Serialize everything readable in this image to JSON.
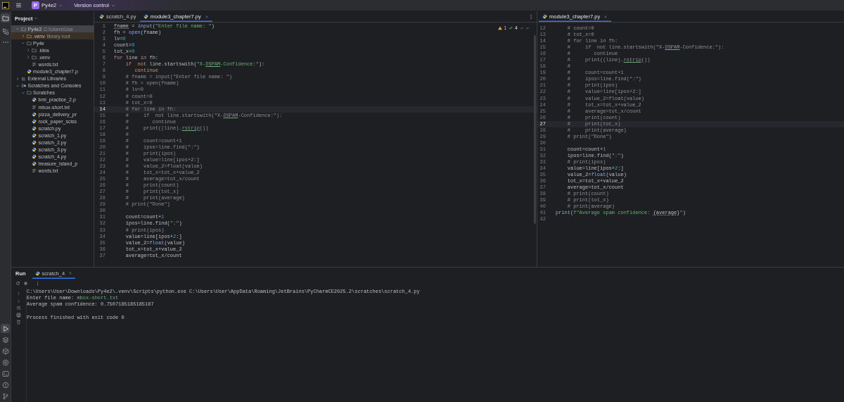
{
  "top_bar": {
    "project_badge": "P",
    "project": "Py4e2",
    "vcs": "Version control"
  },
  "tool_strip": {
    "top": [
      {
        "kind": "project",
        "selected": true
      },
      {
        "kind": "structure",
        "selected": false
      },
      {
        "kind": "more",
        "selected": false
      }
    ],
    "bottom": [
      {
        "kind": "run",
        "selected": true
      },
      {
        "kind": "packages",
        "selected": false
      },
      {
        "kind": "layers",
        "selected": false
      },
      {
        "kind": "console",
        "selected": false
      },
      {
        "kind": "terminal",
        "selected": false
      },
      {
        "kind": "problems",
        "selected": false
      },
      {
        "kind": "vcs",
        "selected": false
      }
    ]
  },
  "project": {
    "title": "Project",
    "tree": [
      {
        "label": "Py4e2",
        "kind": "folder",
        "note": "C:\\Users\\Use",
        "selected": true,
        "expanded": true,
        "children": [
          {
            "label": ".venv",
            "kind": "venv",
            "note": "library root",
            "selected": false,
            "expanded": false
          },
          {
            "label": "Py4e",
            "kind": "folder",
            "selected": false,
            "expanded": true,
            "children": [
              {
                "label": ".idea",
                "kind": "folder",
                "selected": false,
                "expanded": false
              },
              {
                "label": ".venv",
                "kind": "folder",
                "selected": false,
                "expanded": false
              },
              {
                "label": "words.txt",
                "kind": "text",
                "selected": false
              }
            ]
          },
          {
            "label": "module3_chapter7.p",
            "kind": "python",
            "selected": false
          }
        ]
      },
      {
        "label": "External Libraries",
        "kind": "library",
        "selected": false,
        "expanded": false
      },
      {
        "label": "Scratches and Consoles",
        "kind": "scratches",
        "selected": false,
        "expanded": true,
        "children": [
          {
            "label": "Scratches",
            "kind": "folder",
            "selected": false,
            "expanded": true,
            "children": [
              {
                "label": "bmi_practice_2.p",
                "kind": "python",
                "selected": false
              },
              {
                "label": "mbox-short.txt",
                "kind": "text",
                "selected": false
              },
              {
                "label": "pizza_delivery_pr",
                "kind": "python",
                "selected": false
              },
              {
                "label": "rock_paper_sciss",
                "kind": "python",
                "selected": false
              },
              {
                "label": "scratch.py",
                "kind": "python",
                "selected": false
              },
              {
                "label": "scratch_1.py",
                "kind": "python",
                "selected": false
              },
              {
                "label": "scratch_2.py",
                "kind": "python",
                "selected": false
              },
              {
                "label": "scratch_3.py",
                "kind": "python",
                "selected": false
              },
              {
                "label": "scratch_4.py",
                "kind": "python",
                "selected": false
              },
              {
                "label": "treasure_island_p",
                "kind": "python",
                "selected": false
              },
              {
                "label": "words.txt",
                "kind": "text",
                "selected": false
              }
            ]
          }
        ]
      }
    ]
  },
  "editors": [
    {
      "tabs": [
        {
          "label": "scratch_4.py",
          "selected": false
        },
        {
          "label": "module3_chapter7.py",
          "selected": true
        }
      ],
      "inspections": {
        "warnings": "1",
        "checks": "4"
      },
      "lines": [
        {
          "n": "1",
          "current": false,
          "segs": [
            {
              "kind": "marked",
              "text": "fname"
            },
            {
              "kind": "plain",
              "text": " = "
            },
            {
              "kind": "builtin",
              "text": "input"
            },
            {
              "kind": "plain",
              "text": "("
            },
            {
              "kind": "string",
              "text": "\"Enter file name: \""
            },
            {
              "kind": "plain",
              "text": ")"
            }
          ]
        },
        {
          "n": "2",
          "current": false,
          "segs": [
            {
              "kind": "plain",
              "text": "fh = "
            },
            {
              "kind": "builtin",
              "text": "open"
            },
            {
              "kind": "plain",
              "text": "(fname)"
            }
          ]
        },
        {
          "n": "3",
          "current": false,
          "segs": [
            {
              "kind": "plain",
              "text": "lv="
            },
            {
              "kind": "number",
              "text": "0"
            }
          ]
        },
        {
          "n": "4",
          "current": false,
          "segs": [
            {
              "kind": "plain",
              "text": "count="
            },
            {
              "kind": "number",
              "text": "0"
            }
          ]
        },
        {
          "n": "5",
          "current": false,
          "segs": [
            {
              "kind": "plain",
              "text": "tot_x="
            },
            {
              "kind": "number",
              "text": "0"
            }
          ]
        },
        {
          "n": "6",
          "current": false,
          "segs": [
            {
              "kind": "keyword",
              "text": "for"
            },
            {
              "kind": "plain",
              "text": " line "
            },
            {
              "kind": "keyword",
              "text": "in"
            },
            {
              "kind": "plain",
              "text": " fh:"
            }
          ]
        },
        {
          "n": "7",
          "current": false,
          "segs": [
            {
              "kind": "keyword",
              "text": "    if"
            },
            {
              "kind": "keyword",
              "text": "  not"
            },
            {
              "kind": "plain",
              "text": " line.startswith("
            },
            {
              "kind": "string",
              "text": "\"X-"
            },
            {
              "kind": "typo",
              "text": "DSPAM"
            },
            {
              "kind": "string",
              "text": "-Confidence:\""
            },
            {
              "kind": "plain",
              "text": "):"
            }
          ]
        },
        {
          "n": "8",
          "current": false,
          "segs": [
            {
              "kind": "keyword",
              "text": "       continue"
            }
          ]
        },
        {
          "n": "9",
          "current": false,
          "segs": [
            {
              "kind": "comment",
              "text": "    # fname = input(\"Enter file name: \")"
            }
          ]
        },
        {
          "n": "10",
          "current": false,
          "segs": [
            {
              "kind": "comment",
              "text": "    # fh = open(fname)"
            }
          ]
        },
        {
          "n": "11",
          "current": false,
          "segs": [
            {
              "kind": "comment",
              "text": "    # lv=0"
            }
          ]
        },
        {
          "n": "12",
          "current": false,
          "segs": [
            {
              "kind": "comment",
              "text": "    # count=0"
            }
          ]
        },
        {
          "n": "13",
          "current": false,
          "segs": [
            {
              "kind": "comment",
              "text": "    # tot_x=0"
            }
          ]
        },
        {
          "n": "14",
          "current": true,
          "segs": [
            {
              "kind": "comment",
              "text": "    # for line in fh:"
            }
          ]
        },
        {
          "n": "15",
          "current": false,
          "segs": [
            {
              "kind": "comment",
              "text": "    #     if  not line.startswith(\"X-"
            },
            {
              "kind": "commenttypo",
              "text": "DSPAM"
            },
            {
              "kind": "comment",
              "text": "-Confidence:\"):"
            }
          ]
        },
        {
          "n": "16",
          "current": false,
          "segs": [
            {
              "kind": "comment",
              "text": "    #        continue"
            }
          ]
        },
        {
          "n": "17",
          "current": false,
          "segs": [
            {
              "kind": "comment",
              "text": "    #     print((line)."
            },
            {
              "kind": "commenttypo",
              "text": "rstrip"
            },
            {
              "kind": "comment",
              "text": "())"
            }
          ]
        },
        {
          "n": "18",
          "current": false,
          "segs": [
            {
              "kind": "comment",
              "text": "    #"
            }
          ]
        },
        {
          "n": "19",
          "current": false,
          "segs": [
            {
              "kind": "comment",
              "text": "    #     count=count+1"
            }
          ]
        },
        {
          "n": "20",
          "current": false,
          "segs": [
            {
              "kind": "comment",
              "text": "    #     ipos=line.find(\":\")"
            }
          ]
        },
        {
          "n": "21",
          "current": false,
          "segs": [
            {
              "kind": "comment",
              "text": "    #     print(ipos)"
            }
          ]
        },
        {
          "n": "22",
          "current": false,
          "segs": [
            {
              "kind": "comment",
              "text": "    #     value=line[ipos+2:]"
            }
          ]
        },
        {
          "n": "23",
          "current": false,
          "segs": [
            {
              "kind": "comment",
              "text": "    #     value_2=float(value)"
            }
          ]
        },
        {
          "n": "24",
          "current": false,
          "segs": [
            {
              "kind": "comment",
              "text": "    #     tot_x=tot_x+value_2"
            }
          ]
        },
        {
          "n": "25",
          "current": false,
          "segs": [
            {
              "kind": "comment",
              "text": "    #     average=tot_x/count"
            }
          ]
        },
        {
          "n": "26",
          "current": false,
          "segs": [
            {
              "kind": "comment",
              "text": "    #     print(count)"
            }
          ]
        },
        {
          "n": "27",
          "current": false,
          "segs": [
            {
              "kind": "comment",
              "text": "    #     print(tot_x)"
            }
          ]
        },
        {
          "n": "28",
          "current": false,
          "segs": [
            {
              "kind": "comment",
              "text": "    #     print(average)"
            }
          ]
        },
        {
          "n": "29",
          "current": false,
          "segs": [
            {
              "kind": "comment",
              "text": "    # print(\"Done\")"
            }
          ]
        },
        {
          "n": "30",
          "current": false
        },
        {
          "n": "31",
          "current": false,
          "segs": [
            {
              "kind": "plain",
              "text": "    count=count+"
            },
            {
              "kind": "number",
              "text": "1"
            }
          ]
        },
        {
          "n": "32",
          "current": false,
          "segs": [
            {
              "kind": "plain",
              "text": "    ipos=line.find("
            },
            {
              "kind": "string",
              "text": "\":\""
            },
            {
              "kind": "plain",
              "text": ")"
            }
          ]
        },
        {
          "n": "33",
          "current": false,
          "segs": [
            {
              "kind": "comment",
              "text": "    # print(ipos)"
            }
          ]
        },
        {
          "n": "34",
          "current": false,
          "segs": [
            {
              "kind": "plain",
              "text": "    value=line[ipos+"
            },
            {
              "kind": "number",
              "text": "2"
            },
            {
              "kind": "plain",
              "text": ":]"
            }
          ]
        },
        {
          "n": "35",
          "current": false,
          "segs": [
            {
              "kind": "plain",
              "text": "    value_2="
            },
            {
              "kind": "builtin",
              "text": "float"
            },
            {
              "kind": "plain",
              "text": "(value)"
            }
          ]
        },
        {
          "n": "36",
          "current": false,
          "segs": [
            {
              "kind": "plain",
              "text": "    tot_x=tot_x+value_2"
            }
          ]
        },
        {
          "n": "37",
          "current": false,
          "segs": [
            {
              "kind": "plain",
              "text": "    average=tot_x/count"
            }
          ]
        }
      ]
    },
    {
      "tabs": [
        {
          "label": "module3_chapter7.py",
          "selected": true
        }
      ],
      "lines": [
        {
          "n": "12",
          "current": false,
          "segs": [
            {
              "kind": "comment",
              "text": "    # count=0"
            }
          ]
        },
        {
          "n": "13",
          "current": false,
          "segs": [
            {
              "kind": "comment",
              "text": "    # tot_x=0"
            }
          ]
        },
        {
          "n": "14",
          "current": false,
          "segs": [
            {
              "kind": "comment",
              "text": "    # for line in fh:"
            }
          ]
        },
        {
          "n": "15",
          "current": false,
          "segs": [
            {
              "kind": "comment",
              "text": "    #     if  not line.startswith(\"X-"
            },
            {
              "kind": "commenttypo",
              "text": "DSPAM"
            },
            {
              "kind": "comment",
              "text": "-Confidence:\"):"
            }
          ]
        },
        {
          "n": "16",
          "current": false,
          "segs": [
            {
              "kind": "comment",
              "text": "    #        continue"
            }
          ]
        },
        {
          "n": "17",
          "current": false,
          "segs": [
            {
              "kind": "comment",
              "text": "    #     print((line)."
            },
            {
              "kind": "commenttypo",
              "text": "rstrip"
            },
            {
              "kind": "comment",
              "text": "())"
            }
          ]
        },
        {
          "n": "18",
          "current": false,
          "segs": [
            {
              "kind": "comment",
              "text": "    #"
            }
          ]
        },
        {
          "n": "19",
          "current": false,
          "segs": [
            {
              "kind": "comment",
              "text": "    #     count=count+1"
            }
          ]
        },
        {
          "n": "20",
          "current": false,
          "segs": [
            {
              "kind": "comment",
              "text": "    #     ipos=line.find(\":\")"
            }
          ]
        },
        {
          "n": "21",
          "current": false,
          "segs": [
            {
              "kind": "comment",
              "text": "    #     print(ipos)"
            }
          ]
        },
        {
          "n": "22",
          "current": false,
          "segs": [
            {
              "kind": "comment",
              "text": "    #     value=line[ipos+2:]"
            }
          ]
        },
        {
          "n": "23",
          "current": false,
          "segs": [
            {
              "kind": "comment",
              "text": "    #     value_2=float(value)"
            }
          ]
        },
        {
          "n": "24",
          "current": false,
          "segs": [
            {
              "kind": "comment",
              "text": "    #     tot_x=tot_x+value_2"
            }
          ]
        },
        {
          "n": "25",
          "current": false,
          "segs": [
            {
              "kind": "comment",
              "text": "    #     average=tot_x/count"
            }
          ]
        },
        {
          "n": "26",
          "current": false,
          "segs": [
            {
              "kind": "comment",
              "text": "    #     print(count)"
            }
          ]
        },
        {
          "n": "27",
          "current": true,
          "segs": [
            {
              "kind": "comment",
              "text": "    #     print(tot_x)"
            }
          ]
        },
        {
          "n": "28",
          "current": false,
          "segs": [
            {
              "kind": "comment",
              "text": "    #     print(average)"
            }
          ]
        },
        {
          "n": "29",
          "current": false,
          "segs": [
            {
              "kind": "comment",
              "text": "    # print(\"Done\")"
            }
          ]
        },
        {
          "n": "30",
          "current": false
        },
        {
          "n": "31",
          "current": false,
          "segs": [
            {
              "kind": "plain",
              "text": "    count=count+"
            },
            {
              "kind": "number",
              "text": "1"
            }
          ]
        },
        {
          "n": "32",
          "current": false,
          "segs": [
            {
              "kind": "plain",
              "text": "    ipos=line.find("
            },
            {
              "kind": "string",
              "text": "\":\""
            },
            {
              "kind": "plain",
              "text": ")"
            }
          ]
        },
        {
          "n": "33",
          "current": false,
          "segs": [
            {
              "kind": "comment",
              "text": "    # print(ipos)"
            }
          ]
        },
        {
          "n": "34",
          "current": false,
          "segs": [
            {
              "kind": "plain",
              "text": "    value=line[ipos+"
            },
            {
              "kind": "number",
              "text": "2"
            },
            {
              "kind": "plain",
              "text": ":]"
            }
          ]
        },
        {
          "n": "35",
          "current": false,
          "segs": [
            {
              "kind": "plain",
              "text": "    value_2="
            },
            {
              "kind": "builtin",
              "text": "float"
            },
            {
              "kind": "plain",
              "text": "(value)"
            }
          ]
        },
        {
          "n": "36",
          "current": false,
          "segs": [
            {
              "kind": "plain",
              "text": "    tot_x=tot_x+value_2"
            }
          ]
        },
        {
          "n": "37",
          "current": false,
          "segs": [
            {
              "kind": "plain",
              "text": "    average=tot_x/count"
            }
          ]
        },
        {
          "n": "38",
          "current": false,
          "segs": [
            {
              "kind": "comment",
              "text": "    # print(count)"
            }
          ]
        },
        {
          "n": "39",
          "current": false,
          "segs": [
            {
              "kind": "comment",
              "text": "    # print(tot_x)"
            }
          ]
        },
        {
          "n": "40",
          "current": false,
          "segs": [
            {
              "kind": "comment",
              "text": "    # print(average)"
            }
          ]
        },
        {
          "n": "41",
          "current": false,
          "segs": [
            {
              "kind": "builtin",
              "text": "print"
            },
            {
              "kind": "plain",
              "text": "("
            },
            {
              "kind": "string",
              "text": "f\"Average spam confidence: "
            },
            {
              "kind": "marked",
              "text": "{average}"
            },
            {
              "kind": "string",
              "text": "\""
            },
            {
              "kind": "plain",
              "text": ")"
            }
          ]
        },
        {
          "n": "42",
          "current": false
        }
      ]
    }
  ],
  "run": {
    "title": "Run",
    "tabs": [
      {
        "label": "scratch_4",
        "selected": true
      }
    ],
    "output": [
      [
        [
          {
            "kind": "plain",
            "text": "C:\\Users\\User\\Downloads\\Py4e2\\.venv\\Scripts\\python.exe C:\\Users\\User\\AppData\\Roaming\\JetBrains\\PyCharmCE2025.2\\scratches\\scratch_4.py"
          }
        ],
        [
          {
            "kind": "plain",
            "text": "Enter file name: "
          },
          {
            "kind": "input",
            "text": "mbox-short.txt"
          }
        ],
        [
          {
            "kind": "plain",
            "text": "Average spam confidence: 0.7507185185185187"
          }
        ]
      ],
      [
        [
          {
            "kind": "plain",
            "text": "Process finished with exit code 0"
          }
        ]
      ]
    ]
  }
}
